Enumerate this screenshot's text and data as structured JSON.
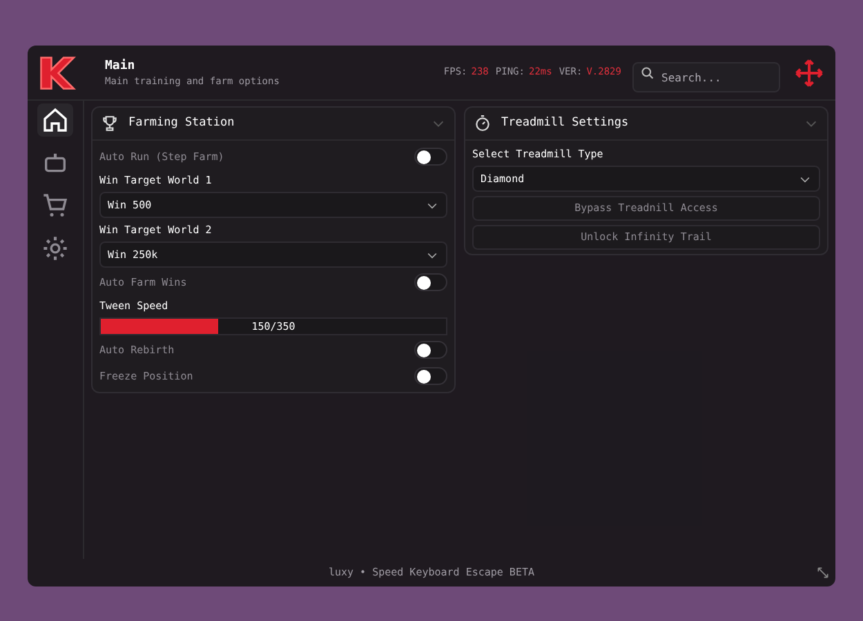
{
  "header": {
    "title": "Main",
    "subtitle": "Main training and farm options"
  },
  "stats": [
    {
      "label": "FPS:",
      "value": "238"
    },
    {
      "label": "PING:",
      "value": "22ms"
    },
    {
      "label": "VER:",
      "value": "V.2829"
    }
  ],
  "search": {
    "placeholder": "Search..."
  },
  "sidebar": {
    "items": [
      {
        "selected": true
      },
      {
        "selected": false
      },
      {
        "selected": false
      },
      {
        "selected": false
      }
    ]
  },
  "panels": [
    {
      "title": "Farming Station",
      "rows": [
        {
          "kind": "toggle",
          "label": "Auto Run (Step Farm)",
          "on": false
        },
        {
          "kind": "dropdown",
          "label": "Win Target World 1",
          "value": "Win 500"
        },
        {
          "kind": "dropdown",
          "label": "Win Target World 2",
          "value": "Win 250k"
        },
        {
          "kind": "toggle",
          "label": "Auto Farm Wins",
          "on": false
        },
        {
          "kind": "slider",
          "label": "Tween Speed",
          "level": 0.34,
          "reading": "150/350"
        },
        {
          "kind": "toggle",
          "label": "Auto Rebirth",
          "on": false
        },
        {
          "kind": "toggle",
          "label": "Freeze Position",
          "on": false
        }
      ]
    },
    {
      "title": "Treadmill Settings",
      "rows": [
        {
          "kind": "dropdown",
          "label": "Select Treadmill Type",
          "value": "Diamond"
        },
        {
          "kind": "button",
          "label": "Bypass Treadnill Access"
        },
        {
          "kind": "button",
          "label": "Unlock Infinity Trail"
        }
      ]
    }
  ],
  "footer": "luxy • Speed Keyboard Escape BETA"
}
